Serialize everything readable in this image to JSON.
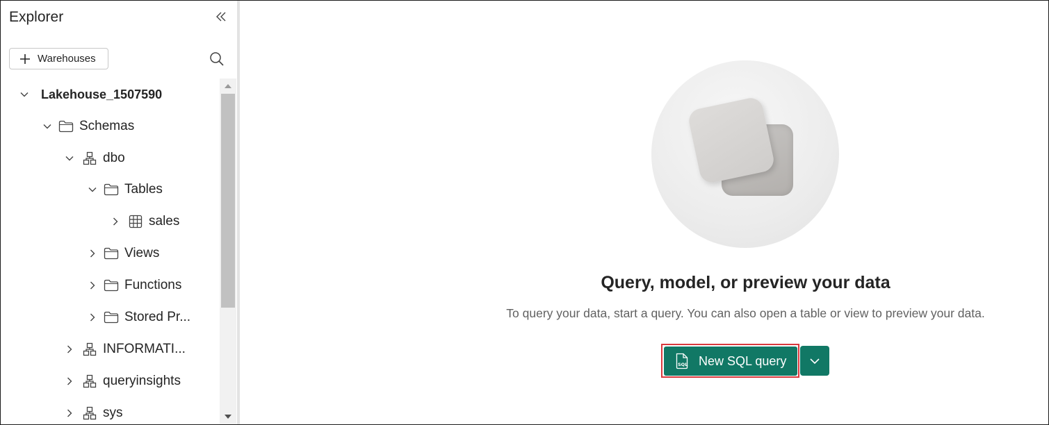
{
  "explorer": {
    "title": "Explorer",
    "collapse_icon": "double-chevron-left-icon",
    "add_warehouses_label": "Warehouses",
    "search_icon": "search-icon"
  },
  "tree": [
    {
      "label": "Lakehouse_1507590",
      "icon": "none",
      "expanded": true
    },
    {
      "label": "Schemas",
      "icon": "folder-icon",
      "expanded": true
    },
    {
      "label": "dbo",
      "icon": "schema-icon",
      "expanded": true
    },
    {
      "label": "Tables",
      "icon": "folder-icon",
      "expanded": true
    },
    {
      "label": "sales",
      "icon": "table-icon",
      "expanded": false
    },
    {
      "label": "Views",
      "icon": "folder-icon",
      "expanded": false
    },
    {
      "label": "Functions",
      "icon": "folder-icon",
      "expanded": false
    },
    {
      "label": "Stored Pr...",
      "icon": "folder-icon",
      "expanded": false
    },
    {
      "label": "INFORMATI...",
      "icon": "schema-icon",
      "expanded": false
    },
    {
      "label": "queryinsights",
      "icon": "schema-icon",
      "expanded": false
    },
    {
      "label": "sys",
      "icon": "schema-icon",
      "expanded": false
    }
  ],
  "main": {
    "headline": "Query, model, or preview your data",
    "subtext": "To query your data, start a query. You can also open a table or view to preview your data.",
    "new_sql_query_label": "New SQL query"
  },
  "colors": {
    "accent": "#117865",
    "highlight_outline": "#d9383c"
  }
}
